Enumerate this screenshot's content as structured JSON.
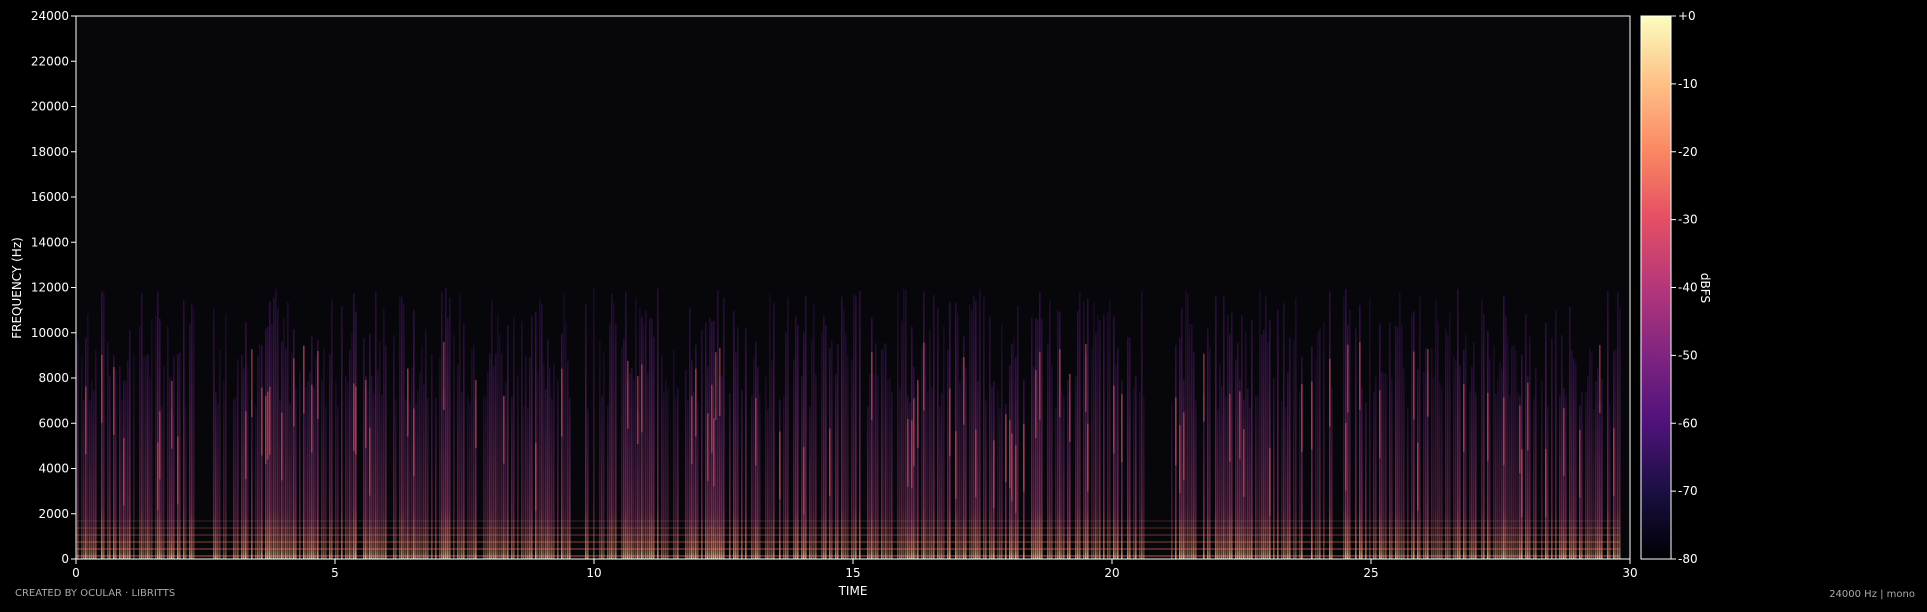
{
  "chart_data": {
    "type": "heatmap",
    "subtype": "spectrogram",
    "xlabel": "TIME",
    "ylabel": "FREQUENCY (Hz)",
    "xlim": [
      0,
      30
    ],
    "ylim": [
      0,
      24000
    ],
    "x_ticks": [
      0,
      5,
      10,
      15,
      20,
      25,
      30
    ],
    "y_ticks": [
      0,
      2000,
      4000,
      6000,
      8000,
      10000,
      12000,
      14000,
      16000,
      18000,
      20000,
      22000,
      24000
    ],
    "colorbar": {
      "label": "dBFS",
      "range": [
        -80,
        0
      ],
      "ticks": [
        "+0",
        "-10",
        "-20",
        "-30",
        "-40",
        "-50",
        "-60",
        "-70",
        "-80"
      ],
      "colormap": "magma"
    },
    "content_cutoff_hz": 12000,
    "colors": {
      "background": "#000000",
      "plot_background": "#07060b",
      "axis": "#ffffff"
    }
  },
  "footer": {
    "credit": "CREATED BY OCULAR · LIBRITTS",
    "info": "24000 Hz | mono"
  }
}
